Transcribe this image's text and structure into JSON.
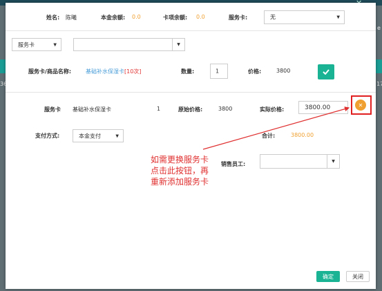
{
  "header": {
    "name_label": "姓名:",
    "name_value": "陈曦",
    "principal_label": "本金余额:",
    "principal_value": "0.0",
    "card_balance_label": "卡项余额:",
    "card_balance_value": "0.0",
    "service_card_label": "服务卡:",
    "service_card_value": "无"
  },
  "search": {
    "type_value": "服务卡",
    "input_value": ""
  },
  "item_row": {
    "label": "服务卡/商品名称:",
    "product_name": "基础补水保湿卡",
    "product_tag": "[10次]",
    "qty_label": "数量:",
    "qty_value": "1",
    "price_label": "价格:",
    "price_value": "3800"
  },
  "list_row": {
    "type": "服务卡",
    "name": "基础补水保湿卡",
    "qty": "1",
    "orig_price_label": "原始价格:",
    "orig_price_value": "3800",
    "actual_price_label": "实际价格:",
    "actual_price_value": "3800.00"
  },
  "payment": {
    "method_label": "支付方式:",
    "method_value": "本金支付",
    "total_label": "合计:",
    "total_value": "3800.00",
    "staff_label": "销售员工:",
    "staff_value": ""
  },
  "annotation": {
    "line1": "如需更换服务卡",
    "line2": "点击此按钮，再",
    "line3": "重新添加服务卡"
  },
  "footer": {
    "confirm_label": "确定",
    "close_label": "关闭"
  },
  "background": {
    "left_fragment": "36",
    "right_fragment": "17",
    "right_edge_text": "e"
  },
  "colors": {
    "accent": "#1ab394",
    "delete_button": "#f0a030",
    "annotation": "#e03030"
  }
}
